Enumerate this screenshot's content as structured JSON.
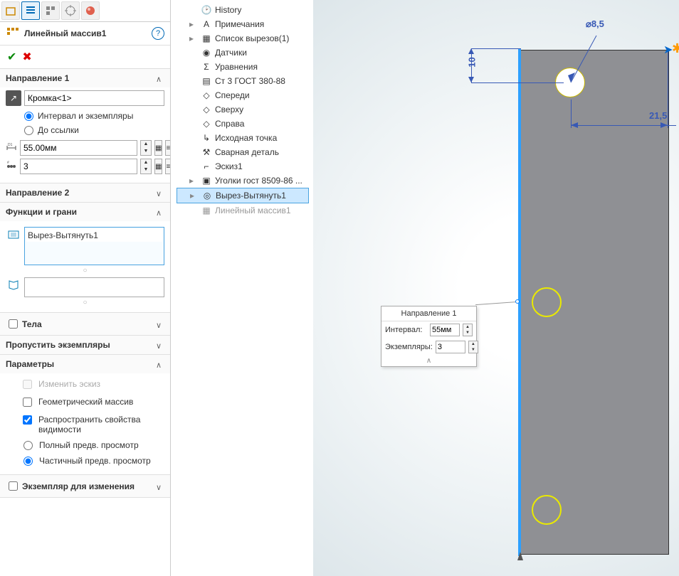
{
  "feature": {
    "title": "Линейный массив1",
    "help": "?"
  },
  "sections": {
    "dir1": {
      "title": "Направление 1",
      "edge": "Кромка<1>",
      "opt_interval": "Интервал и экземпляры",
      "opt_reference": "До ссылки",
      "spacing": "55.00мм",
      "count": "3"
    },
    "dir2": {
      "title": "Направление 2"
    },
    "features": {
      "title": "Функции и грани",
      "item": "Вырез-Вытянуть1"
    },
    "bodies": {
      "title": "Тела"
    },
    "skip": {
      "title": "Пропустить экземпляры"
    },
    "params": {
      "title": "Параметры",
      "c1": "Изменить эскиз",
      "c2": "Геометрический массив",
      "c3": "Распространить свойства видимости",
      "r1": "Полный предв. просмотр",
      "r2": "Частичный предв. просмотр"
    },
    "modify": {
      "title": "Экземпляр для изменения"
    }
  },
  "tree": [
    {
      "label": "History",
      "kind": "history"
    },
    {
      "label": "Примечания",
      "kind": "note"
    },
    {
      "label": "Список вырезов(1)",
      "kind": "cutlist",
      "caret": true
    },
    {
      "label": "Датчики",
      "kind": "sensor"
    },
    {
      "label": "Уравнения",
      "kind": "eq"
    },
    {
      "label": "Ст 3 ГОСТ 380-88",
      "kind": "material"
    },
    {
      "label": "Спереди",
      "kind": "plane"
    },
    {
      "label": "Сверху",
      "kind": "plane"
    },
    {
      "label": "Справа",
      "kind": "plane"
    },
    {
      "label": "Исходная точка",
      "kind": "origin"
    },
    {
      "label": "Сварная деталь",
      "kind": "weld"
    },
    {
      "label": "Эскиз1",
      "kind": "sketch"
    },
    {
      "label": "Уголки гост 8509-86 ...",
      "kind": "feature",
      "caret": true
    },
    {
      "label": "Вырез-Вытянуть1",
      "kind": "cut",
      "sel": true,
      "caret": true
    },
    {
      "label": "Линейный массив1",
      "kind": "pattern",
      "gray": true
    }
  ],
  "popup": {
    "title": "Направление 1",
    "row1_label": "Интервал:",
    "row1_value": "55мм",
    "row2_label": "Экземпляры:",
    "row2_value": "3"
  },
  "dims": {
    "diameter": "⌀8,5",
    "offset_y": "10",
    "offset_x": "21,5"
  }
}
